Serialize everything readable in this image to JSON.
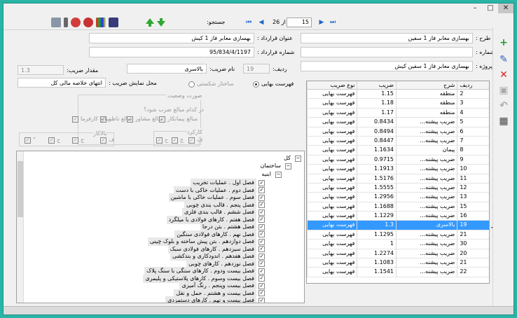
{
  "window": {
    "minimize": "–",
    "maximize": "□",
    "close": "✕"
  },
  "toolbar": {
    "search_label": "جستجو:",
    "record_current": "15",
    "record_of": "از 26",
    "icons": [
      "map-icon",
      "calc-icon",
      "report-icon",
      "color-icon",
      "user-icon",
      "arrow-up-icon",
      "arrow-down-icon"
    ]
  },
  "header": {
    "plan_label": "طرح :",
    "plan_value": "بهسازی معابر فاز 1 سفین",
    "number_label": "شماره :",
    "number_value": "",
    "project_label": "پروژه :",
    "project_value": "بهسازی معابر فاز 1 سفین کیش",
    "contract_title_label": "عنوان قرارداد :",
    "contract_title_value": "بهسازی معابر فاز 1 کیش",
    "contract_number_label": "شماره قرارداد :",
    "contract_number_value": "95/834/4/1197",
    "row_label": "ردیف:",
    "row_value": "19",
    "coef_name_label": "نام ضریب:",
    "coef_name_value": "بالاسری",
    "coef_amount_label": "مقدار ضریب:",
    "coef_amount_value": "1.3"
  },
  "options": {
    "price_list": "فهرست بهایی",
    "breakdown": "ساختار شکستی",
    "display_place_label": "محل نمایش ضریب :",
    "display_place_value": "انتهای خلاصه مالی کل",
    "status_group": "صورت وضعیت",
    "which_amounts": "در کدام مبالغ ضرب شود؟",
    "amount_contractor": "مبالغ پیمانکار",
    "amount_consultant": "مبالغ مشاور",
    "amount_supervisor": "مبالغ ناظر",
    "amount_employer": "مبالغ کارفرما",
    "workshop_group": "کارکرد",
    "bala_group": "بالاکار",
    "chk_f": "ف",
    "chk_j": "ج",
    "chk_h": "ح",
    "chk_s": "\""
  },
  "grid": {
    "headers": {
      "row": "ردیف",
      "desc": "شرح",
      "coef": "ضریب",
      "type": "نوع ضریب"
    },
    "rows": [
      {
        "row": "2",
        "desc": "منطقه",
        "coef": "1.15",
        "type": "فهرست بهایی"
      },
      {
        "row": "3",
        "desc": "منطقه",
        "coef": "1.18",
        "type": "فهرست بهایی"
      },
      {
        "row": "4",
        "desc": "منطقه",
        "coef": "1.17",
        "type": "فهرست بهایی"
      },
      {
        "row": "5",
        "desc": "ضریب پیشنه...",
        "coef": "0.8434",
        "type": "فهرست بهایی"
      },
      {
        "row": "6",
        "desc": "ضریب پیشنه...",
        "coef": "0.8494",
        "type": "فهرست بهایی"
      },
      {
        "row": "7",
        "desc": "ضریب پیشنه...",
        "coef": "0.8447",
        "type": "فهرست بهایی"
      },
      {
        "row": "8",
        "desc": "پیمان",
        "coef": "1.1634",
        "type": "فهرست بهایی"
      },
      {
        "row": "9",
        "desc": "ضریب پیشنه...",
        "coef": "0.9715",
        "type": "فهرست بهایی"
      },
      {
        "row": "10",
        "desc": "ضریب پیشنه...",
        "coef": "1.1913",
        "type": "فهرست بهایی"
      },
      {
        "row": "11",
        "desc": "ضریب پیشنه...",
        "coef": "1.5176",
        "type": "فهرست بهایی"
      },
      {
        "row": "12",
        "desc": "ضریب پیشنه...",
        "coef": "1.5555",
        "type": "فهرست بهایی"
      },
      {
        "row": "13",
        "desc": "ضریب پیشنه...",
        "coef": "1.2956",
        "type": "فهرست بهایی"
      },
      {
        "row": "15",
        "desc": "ضریب پیشنه...",
        "coef": "1.1688",
        "type": "فهرست بهایی"
      },
      {
        "row": "16",
        "desc": "ضریب پیشنه...",
        "coef": "1.1229",
        "type": "فهرست بهایی"
      },
      {
        "row": "19",
        "desc": "بالاسری",
        "coef": "1.3",
        "type": "فهرست بهایی"
      },
      {
        "row": "21",
        "desc": "ضریب پیشنه...",
        "coef": "1.1295",
        "type": "فهرست بهایی"
      },
      {
        "row": "30",
        "desc": "ضریب پیشنه...",
        "coef": "1",
        "type": "فهرست بهایی"
      },
      {
        "row": "20",
        "desc": "ضریب پیشنه...",
        "coef": "1.2274",
        "type": "فهرست بهایی"
      },
      {
        "row": "21",
        "desc": "ضریب پیشنه...",
        "coef": "1.1083",
        "type": "فهرست بهایی"
      },
      {
        "row": "22",
        "desc": "ضریب پیشنه...",
        "coef": "1.1541",
        "type": "فهرست بهایی"
      }
    ],
    "selected_index": 14
  },
  "tree": {
    "root": "کل",
    "buildings": "ساختمان",
    "abnieh": "ابنیه",
    "items": [
      "فصل اول . عملیات تخریب",
      "فصل دوم . عملیات خاکی با دست",
      "فصل سوم . عملیات خاکی با ماشین",
      "فصل پنجم . قالب بندی چوبی",
      "فصل ششم . قالب بندی فلزی",
      "فصل هفتم . کارهای فولادی با میلگرد",
      "فصل هشتم . بتن درجا",
      "فصل نهم . کارهای فولادی سنگین",
      "فصل دوازدهم . بتن پیش ساخته و بلوک چینی",
      "فصل سیزدهم . کارهای فولادی سبک",
      "فصل هفدهم . اندودکاری و بندکشی",
      "فصل نوزدهم . کارهای چوبی",
      "فصل بیست ودوم . کارهای سنگی با سنگ پلاک",
      "فصل بیست وسوم . کارهای پلاستیکی و پلیمری",
      "فصل بیست وپنجم . رنگ آمیزی",
      "فصل بیست و هشتم . حمل و نقل",
      "فصل بیست و نهم . کارهای دستمزدی"
    ]
  },
  "sidebar": {
    "icons": [
      "add-icon",
      "edit-icon",
      "delete-icon",
      "save-icon",
      "undo-icon",
      "calculator-icon"
    ]
  },
  "status": {
    "left": "... ... .. ...",
    "right": "... ... ..."
  }
}
